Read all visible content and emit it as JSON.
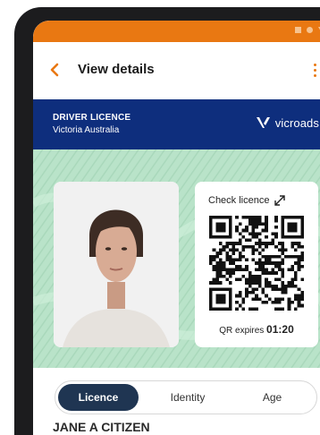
{
  "appbar": {
    "title": "View details"
  },
  "licence": {
    "type": "DRIVER LICENCE",
    "state": "Victoria Australia",
    "brand": "vicroads"
  },
  "qr": {
    "check_label": "Check licence",
    "expiry_label": "QR expires",
    "expiry_time": "01:20"
  },
  "tabs": [
    {
      "label": "Licence",
      "active": true
    },
    {
      "label": "Identity",
      "active": false
    },
    {
      "label": "Age",
      "active": false
    }
  ],
  "holder": {
    "name": "JANE A CITIZEN"
  },
  "colors": {
    "status_bar": "#e97812",
    "header_band": "#0e2e7d",
    "card_background": "#b9e3c9",
    "active_tab": "#1f3552",
    "accent": "#e97812"
  },
  "icons": [
    "back-chevron-icon",
    "more-vertical-icon",
    "vicroads-logo-icon",
    "expand-icon",
    "qr-code"
  ]
}
